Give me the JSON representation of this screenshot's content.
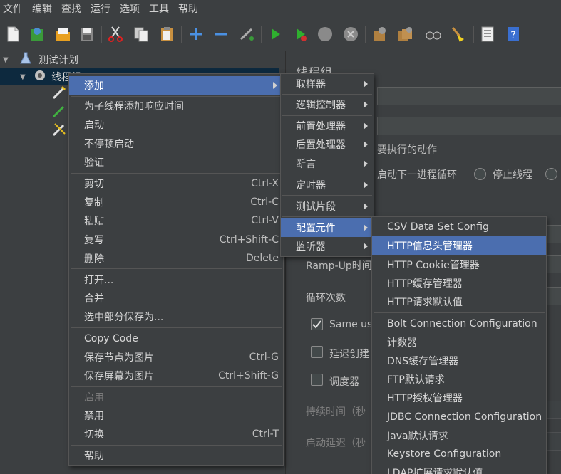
{
  "menubar": [
    "文件",
    "编辑",
    "查找",
    "运行",
    "选项",
    "工具",
    "帮助"
  ],
  "tree": {
    "root_label": "测试计划",
    "thread_group_label": "线程组"
  },
  "right": {
    "title": "线程组",
    "action_label": "要执行的动作",
    "radio_next_loop": "启动下一进程循环",
    "radio_stop_thread": "停止线程",
    "rampup_label": "Ramp-Up时间",
    "loop_label": "循环次数",
    "same_user_label": "Same use",
    "delay_create_label": "延迟创建",
    "scheduler_label": "调度器",
    "duration_label": "持续时间（秒",
    "startup_delay_label": "启动延迟（秒"
  },
  "context_menu": {
    "items": [
      {
        "label": "添加",
        "shortcut": "",
        "submenu": true,
        "selected": true
      },
      {
        "label": "为子线程添加响应时间",
        "shortcut": ""
      },
      {
        "label": "启动",
        "shortcut": ""
      },
      {
        "label": "不停顿启动",
        "shortcut": ""
      },
      {
        "label": "验证",
        "shortcut": ""
      },
      {
        "label": "剪切",
        "shortcut": "Ctrl-X"
      },
      {
        "label": "复制",
        "shortcut": "Ctrl-C"
      },
      {
        "label": "粘贴",
        "shortcut": "Ctrl-V"
      },
      {
        "label": "复写",
        "shortcut": "Ctrl+Shift-C"
      },
      {
        "label": "删除",
        "shortcut": "Delete"
      },
      {
        "label": "打开...",
        "shortcut": ""
      },
      {
        "label": "合并",
        "shortcut": ""
      },
      {
        "label": "选中部分保存为...",
        "shortcut": ""
      },
      {
        "label": "Copy Code",
        "shortcut": ""
      },
      {
        "label": "保存节点为图片",
        "shortcut": "Ctrl-G"
      },
      {
        "label": "保存屏幕为图片",
        "shortcut": "Ctrl+Shift-G"
      },
      {
        "label": "启用",
        "shortcut": "",
        "disabled": true
      },
      {
        "label": "禁用",
        "shortcut": ""
      },
      {
        "label": "切换",
        "shortcut": "Ctrl-T"
      },
      {
        "label": "帮助",
        "shortcut": ""
      }
    ]
  },
  "add_submenu": {
    "items": [
      {
        "label": "取样器"
      },
      {
        "label": "逻辑控制器"
      },
      {
        "label": "前置处理器"
      },
      {
        "label": "后置处理器"
      },
      {
        "label": "断言"
      },
      {
        "label": "定时器"
      },
      {
        "label": "测试片段"
      },
      {
        "label": "配置元件",
        "selected": true
      },
      {
        "label": "监听器"
      }
    ]
  },
  "config_submenu": {
    "items": [
      {
        "label": "CSV Data Set Config"
      },
      {
        "label": "HTTP信息头管理器",
        "selected": true
      },
      {
        "label": "HTTP Cookie管理器"
      },
      {
        "label": "HTTP缓存管理器"
      },
      {
        "label": "HTTP请求默认值"
      },
      {
        "label": "Bolt Connection Configuration"
      },
      {
        "label": "计数器"
      },
      {
        "label": "DNS缓存管理器"
      },
      {
        "label": "FTP默认请求"
      },
      {
        "label": "HTTP授权管理器"
      },
      {
        "label": "JDBC Connection Configuration"
      },
      {
        "label": "Java默认请求"
      },
      {
        "label": "Keystore Configuration"
      },
      {
        "label": "LDAP扩展请求默认值"
      }
    ]
  }
}
